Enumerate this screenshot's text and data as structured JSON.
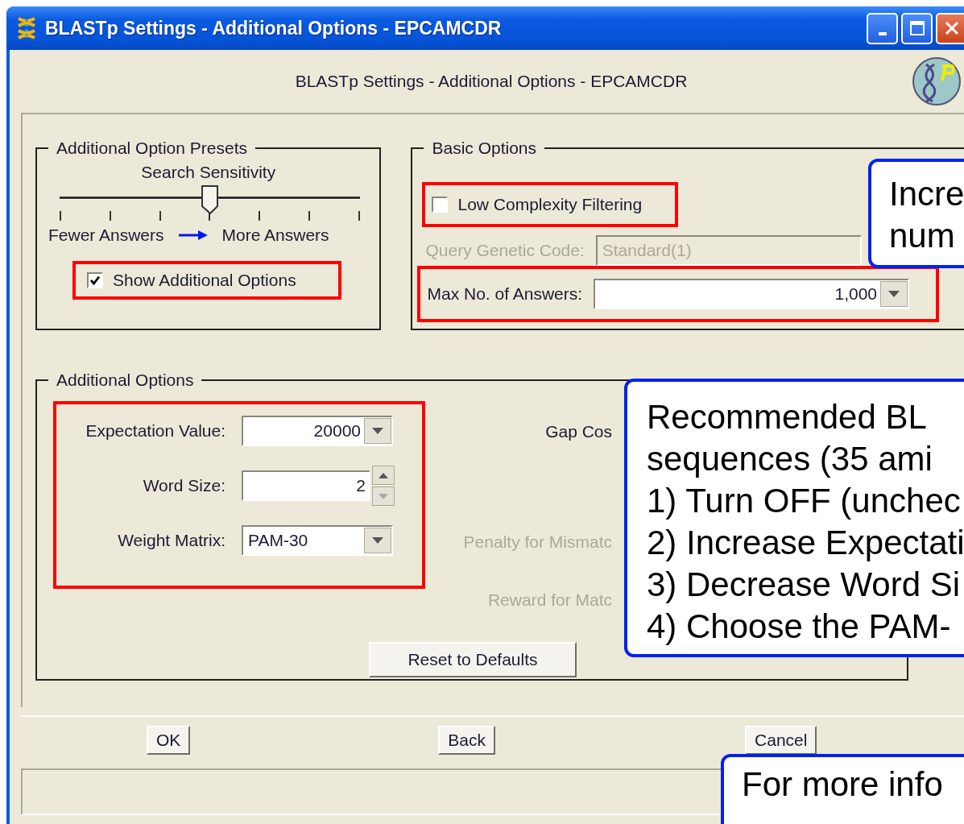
{
  "window": {
    "title": "BLASTp Settings - Additional Options - EPCAMCDR"
  },
  "header": {
    "title": "BLASTp Settings - Additional Options - EPCAMCDR"
  },
  "presets": {
    "title": "Additional Option Presets",
    "slider": {
      "label": "Search Sensitivity",
      "level": 0.5,
      "low_label": "Fewer Answers",
      "high_label": "More Answers"
    },
    "show_additional": {
      "label": "Show Additional Options",
      "checked": true
    }
  },
  "basic": {
    "title": "Basic Options",
    "low_complexity": {
      "label": "Low Complexity Filtering",
      "checked": false
    },
    "genetic_code": {
      "label": "Query Genetic Code:",
      "value": "Standard(1)",
      "disabled": true
    },
    "max_answers": {
      "label": "Max No. of Answers:",
      "value": "1,000"
    }
  },
  "additional": {
    "title": "Additional Options",
    "fields": [
      {
        "kind": "combo",
        "label": "Expectation Value:",
        "value": "20000"
      },
      {
        "kind": "spinner",
        "label": "Word Size:",
        "value": "2"
      },
      {
        "kind": "select",
        "label": "Weight Matrix:",
        "value": "PAM-30"
      }
    ],
    "gap_labels": [
      {
        "label": "Gap Cos",
        "disabled": false
      },
      {
        "label": "Penalty for Mismatc",
        "disabled": true
      },
      {
        "label": "Reward for Matc",
        "disabled": true
      }
    ],
    "reset_button": "Reset to Defaults"
  },
  "buttons": [
    {
      "label": "OK"
    },
    {
      "label": "Back"
    },
    {
      "label": "Cancel"
    }
  ],
  "callouts": [
    {
      "lines": [
        "Incre",
        "num"
      ]
    },
    {
      "lines": [
        "Recommended BL",
        "sequences (35 ami",
        "1) Turn OFF (unchec",
        "2) Increase Expectati",
        "3) Decrease Word Si",
        "4) Choose the PAM-"
      ]
    },
    {
      "lines": [
        "For more info"
      ]
    }
  ]
}
